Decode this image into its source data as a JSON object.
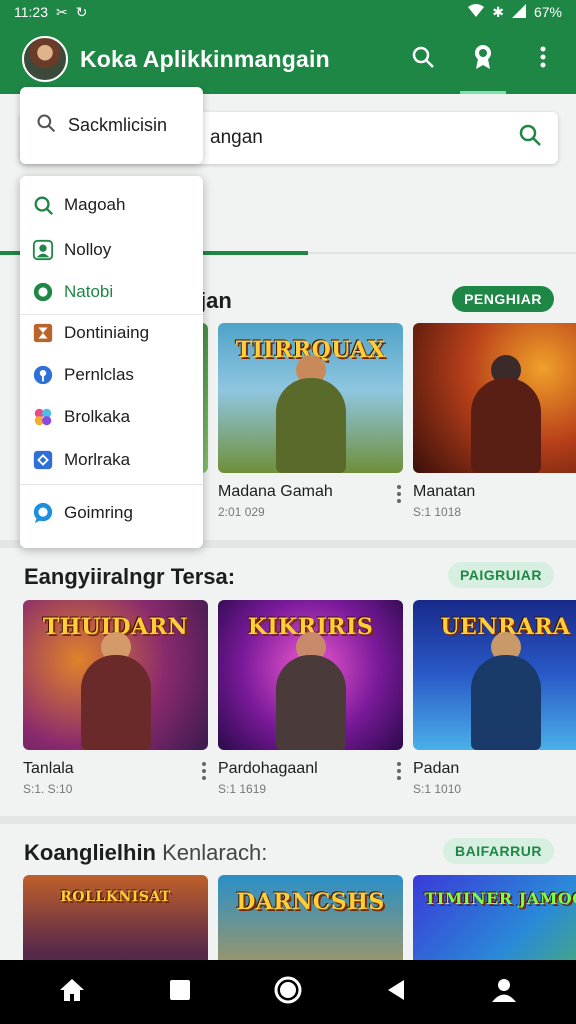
{
  "status": {
    "time": "11:23",
    "battery": "67%"
  },
  "app": {
    "title": "Koka Aplikkinmangain"
  },
  "search": {
    "value": "angan"
  },
  "menu": {
    "search_label": "Sackmlicisin",
    "items": [
      {
        "label": "Magoah",
        "icon": "search-badge-icon",
        "color": "#1e8746"
      },
      {
        "label": "Nolloy",
        "icon": "user-icon",
        "color": "#1e8746"
      },
      {
        "label": "Natobi",
        "icon": "chat-icon",
        "color": "#1e8746",
        "selected": true
      },
      {
        "label": "Dontiniaing",
        "icon": "hourglass-icon",
        "color": "#b8642a"
      },
      {
        "label": "Pernlclas",
        "icon": "location-icon",
        "color": "#2f6fd8"
      },
      {
        "label": "Brolkaka",
        "icon": "palette-icon",
        "color": "#e64c8a"
      },
      {
        "label": "Morlraka",
        "icon": "puzzle-icon",
        "color": "#2f6fd8"
      },
      {
        "label": "Goimring",
        "icon": "message-icon",
        "color": "#1c8fe0"
      }
    ]
  },
  "sections": [
    {
      "title": "jan",
      "button": "PENGHIAR",
      "cards": [
        {
          "name": "",
          "sub": "",
          "colors": [
            "#2f7a3a",
            "#86c26a"
          ]
        },
        {
          "name": "Madana Gamah",
          "sub": "2:01 029",
          "banner": "TIIRRQUAX",
          "colors": [
            "#4fa3c9",
            "#6f8f3a"
          ]
        },
        {
          "name": "Manatan",
          "sub": "S:1 1018",
          "banner": "",
          "colors": [
            "#7a1f0f",
            "#e2701c"
          ]
        }
      ]
    },
    {
      "title": "Eangyiiralngr Tersa:",
      "button": "PAIGRUIAR",
      "cards": [
        {
          "name": "Tanlala",
          "sub": "S:1. S:10",
          "banner": "THUIDARN",
          "colors": [
            "#5a2a6e",
            "#e0832a"
          ]
        },
        {
          "name": "Pardohagaanl",
          "sub": "S:1 1619",
          "banner": "KIKRIRIS",
          "colors": [
            "#6a1a8a",
            "#d94ac0"
          ]
        },
        {
          "name": "Padan",
          "sub": "S:1 1010",
          "banner": "UENRARA",
          "colors": [
            "#182a8a",
            "#4ab0e8"
          ]
        }
      ]
    },
    {
      "title": "Koanglielhin",
      "title_light": "Kenlarach:",
      "button": "BAIFARRUR",
      "cards": [
        {
          "name": "",
          "sub": "",
          "banner": "ROLLKNISAT",
          "colors": [
            "#2a1f4a",
            "#c0602a"
          ]
        },
        {
          "name": "",
          "sub": "",
          "banner": "DARNCSHS",
          "colors": [
            "#2a90c8",
            "#e89a2a"
          ]
        },
        {
          "name": "",
          "sub": "",
          "banner": "TIMINER JAMOO",
          "colors": [
            "#3a3ad8",
            "#5ac03a"
          ]
        }
      ]
    }
  ]
}
